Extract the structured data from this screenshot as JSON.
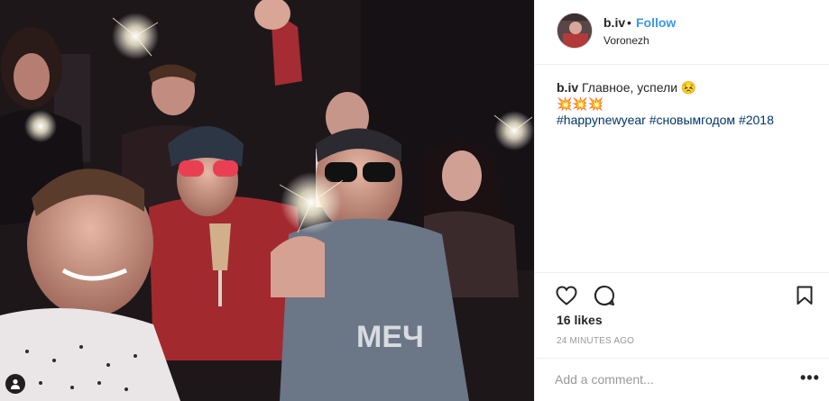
{
  "post": {
    "username": "b.iv",
    "separator": "•",
    "follow_label": "Follow",
    "location": "Voronezh",
    "caption_user": "b.iv",
    "caption_text": "Главное, успели 😣",
    "caption_emoji_line": "💥💥💥",
    "hashtags": [
      "#happynewyear",
      "#сновымгодом",
      "#2018"
    ],
    "likes": "16 likes",
    "timestamp": "24 MINUTES AGO",
    "comment_placeholder": "Add a comment...",
    "more_label": "•••"
  },
  "icons": {
    "like": "heart-icon",
    "comment": "comment-bubble-icon",
    "save": "bookmark-icon",
    "tag": "user-tag-icon"
  },
  "colors": {
    "follow": "#3897f0",
    "hashtag": "#003569",
    "meta": "#999999",
    "border": "#efefef"
  }
}
